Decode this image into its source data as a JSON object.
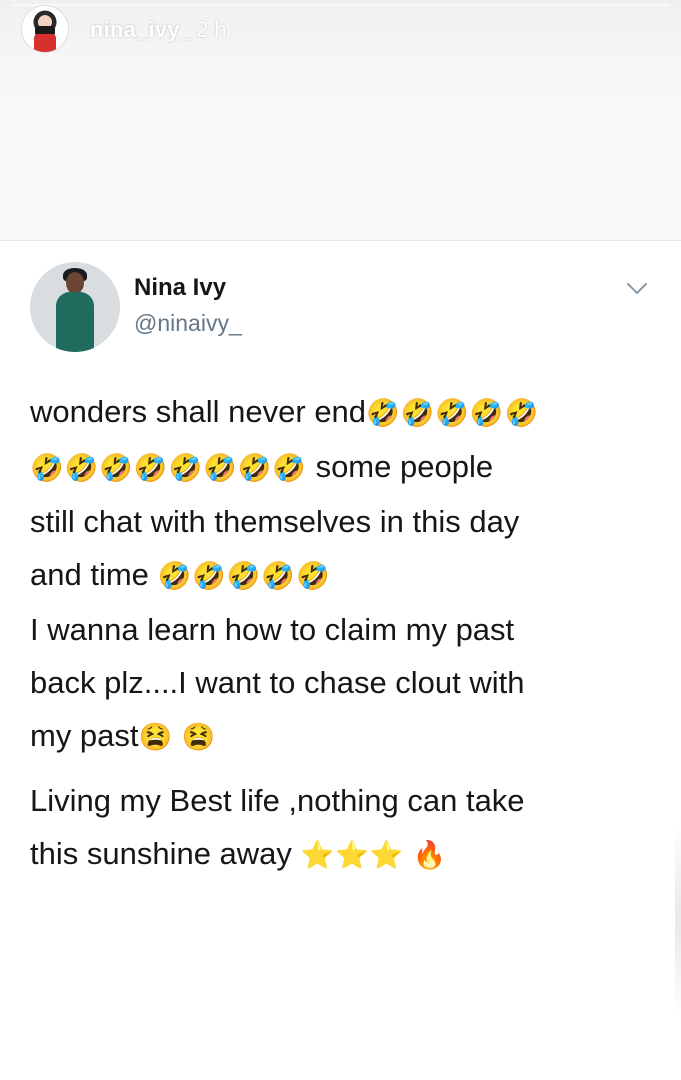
{
  "story": {
    "username": "nina_ivy_",
    "time": "2 h"
  },
  "tweet": {
    "name": "Nina Ivy",
    "handle": "@ninaivy_",
    "lines": [
      {
        "text": "wonders shall never end",
        "emoji": "🤣🤣🤣🤣🤣"
      },
      {
        "text_before_emoji": "",
        "emoji": "🤣🤣🤣🤣🤣🤣🤣🤣",
        "text": " some people"
      },
      {
        "text": "still chat with themselves in this day",
        "emoji": ""
      },
      {
        "text": "and time ",
        "emoji": "🤣🤣🤣🤣🤣"
      },
      {
        "text": "I wanna learn how to claim my past",
        "emoji": ""
      },
      {
        "text": "back plz....I want to chase clout with",
        "emoji": ""
      },
      {
        "text": "my past",
        "emoji": "😫 😫"
      },
      {
        "text": "Living my Best life ,nothing can take",
        "emoji": ""
      },
      {
        "text": "this sunshine away ",
        "emoji": "⭐⭐⭐ 🔥"
      }
    ]
  },
  "icons": {
    "chevron": "chevron-down-icon"
  },
  "colors": {
    "name": "#14171a",
    "handle": "#657786",
    "body": "#14171a",
    "username_overlay": "#ffffff"
  }
}
